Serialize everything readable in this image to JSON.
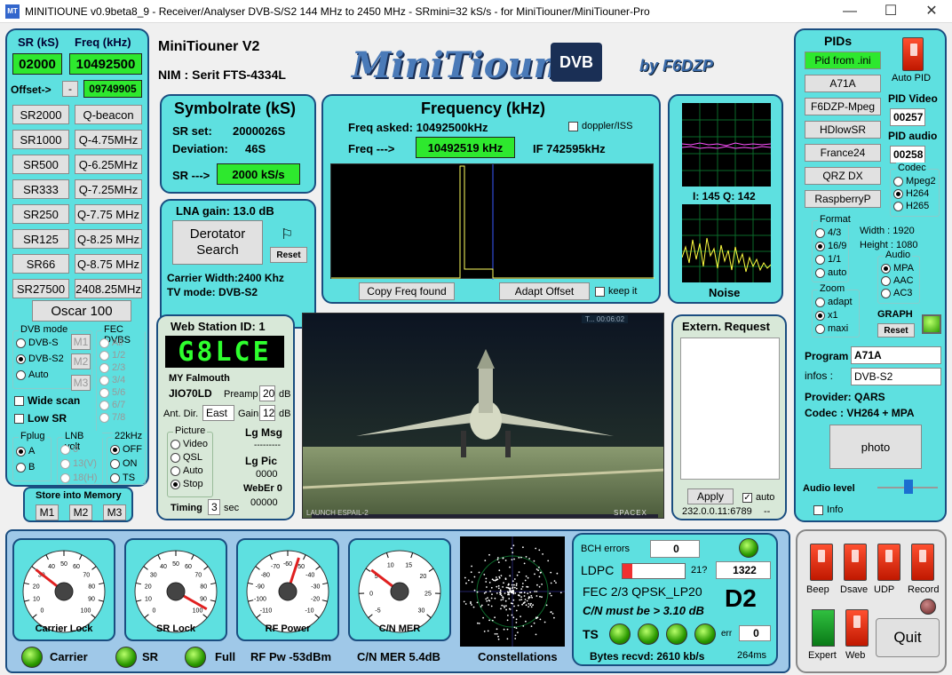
{
  "window": {
    "title": "MINITIOUNE v0.9beta8_9 - Receiver/Analyser DVB-S/S2 144 MHz to 2450 MHz - SRmini=32 kS/s - for MiniTiouner/MiniTiouner-Pro",
    "min": "—",
    "max": "☐",
    "close": "✕",
    "icon": "app-icon"
  },
  "header": {
    "model": "MiniTiouner V2",
    "nim": "NIM : Serit FTS-4334L",
    "logo_text": "MiniTioune",
    "logo_dvb": "DVB",
    "byline": "by F6DZP"
  },
  "left": {
    "sr_label": "SR (kS)",
    "freq_label": "Freq (kHz)",
    "sr_value": "02000",
    "freq_value": "10492500",
    "offset_label": "Offset->",
    "offset_sign": "-",
    "offset_value": "09749905",
    "sr_buttons": [
      "SR2000",
      "SR1000",
      "SR500",
      "SR333",
      "SR250",
      "SR125",
      "SR66",
      "SR27500"
    ],
    "freq_buttons": [
      "Q-beacon",
      "Q-4.75MHz",
      "Q-6.25MHz",
      "Q-7.25MHz",
      "Q-7.75 MHz",
      "Q-8.25 MHz",
      "Q-8.75 MHz",
      "2408.25MHz"
    ],
    "oscar": "Oscar 100",
    "dvbmode": {
      "title": "DVB mode",
      "options": [
        "DVB-S",
        "DVB-S2",
        "Auto"
      ],
      "selected": 1
    },
    "mem_buttons": [
      "M1",
      "M2",
      "M3"
    ],
    "fec": {
      "title": "FEC DVBS",
      "options": [
        "All",
        "1/2",
        "2/3",
        "3/4",
        "5/6",
        "6/7",
        "7/8"
      ]
    },
    "wide_scan": "Wide scan",
    "low_sr": "Low SR",
    "fplug": {
      "title": "Fplug",
      "options": [
        "A",
        "B"
      ]
    },
    "lnb": {
      "title": "LNB volt",
      "options": [
        "0",
        "13(V)",
        "18(H)"
      ]
    },
    "khz22": {
      "title": "22kHz",
      "options": [
        "OFF",
        "ON",
        "TS"
      ]
    },
    "store": {
      "title": "Store into Memory",
      "buttons": [
        "M1",
        "M2",
        "M3"
      ]
    }
  },
  "symbol": {
    "title": "Symbolrate (kS)",
    "srset_label": "SR set:",
    "srset_value": "2000026S",
    "dev_label": "Deviation:",
    "dev_value": "46S",
    "sr_arrow": "SR --->",
    "sr_value": "2000 kS/s"
  },
  "lna": {
    "gain": "LNA gain:  13.0 dB",
    "derot": "Derotator Search",
    "reset": "Reset",
    "flag": "flag-icon",
    "carrier": "Carrier Width:2400 Khz",
    "tvmode": "TV mode: DVB-S2"
  },
  "freq": {
    "title": "Frequency (kHz)",
    "asked": "Freq asked: 10492500kHz",
    "doppler": "doppler/ISS",
    "arrow": "Freq --->",
    "value": "10492519 kHz",
    "if": "IF  742595kHz",
    "copy": "Copy Freq found",
    "adapt": "Adapt Offset",
    "keep": "keep it"
  },
  "iq": {
    "text": "I: 145  Q: 142",
    "noise": "Noise"
  },
  "web": {
    "title": "Web Station ID: 1",
    "callsign": "G8LCE",
    "location": "MY Falmouth",
    "locator": "JIO70LD",
    "preamp_label": "Preamp",
    "preamp": "20",
    "db1": "dB",
    "ant_label": "Ant. Dir.",
    "ant": "East",
    "gain_label": "Gain",
    "gain": "12",
    "db2": "dB",
    "picture": {
      "title": "Picture",
      "options": [
        "Video",
        "QSL",
        "Auto",
        "Stop"
      ],
      "selected": 3
    },
    "lgmsg": "Lg Msg",
    "lgmsg_val": "---------",
    "lgpic": "Lg Pic",
    "lgpic_val": "0000",
    "weber": "WebEr 0",
    "weber_val": "00000",
    "timing": "Timing",
    "timing_val": "3",
    "sec": "sec"
  },
  "video": {
    "top_tag": "T...    00:06:02",
    "caption": "LAUNCH   ESPAIL-2",
    "brand": "SPACEX"
  },
  "extern": {
    "title": "Extern. Request",
    "apply": "Apply",
    "auto": "auto",
    "addr": "232.0.0.11:6789",
    "dash": "--"
  },
  "pids": {
    "title": "PIDs",
    "buttons": [
      "Pid from .ini",
      "A71A",
      "F6DZP-Mpeg",
      "HDlowSR",
      "France24",
      "QRZ DX",
      "RaspberryP"
    ],
    "auto_pid": "Auto PID",
    "pid_video_label": "PID Video",
    "pid_video": "00257",
    "pid_audio_label": "PID audio",
    "pid_audio": "00258",
    "codec": {
      "title": "Codec",
      "options": [
        "Mpeg2",
        "H264",
        "H265"
      ],
      "selected": 1
    },
    "format": {
      "title": "Format",
      "options": [
        "4/3",
        "16/9",
        "1/1",
        "auto"
      ],
      "selected": 1
    },
    "width": "Width :    1920",
    "height": "Height :   1080",
    "audio": {
      "title": "Audio",
      "options": [
        "MPA",
        "AAC",
        "AC3"
      ],
      "selected": 0
    },
    "zoom": {
      "title": "Zoom",
      "options": [
        "adapt",
        "x1",
        "maxi"
      ],
      "selected": 1
    },
    "graph": "GRAPH",
    "graph_reset": "Reset",
    "program_label": "Program",
    "program": "A71A",
    "infos_label": "infos :",
    "infos": "DVB-S2",
    "provider": "Provider: QARS",
    "codec_line": "Codec :    VH264 + MPA",
    "photo": "photo",
    "audio_level": "Audio level",
    "info": "Info"
  },
  "gauges": [
    {
      "name": "Carrier Lock",
      "ticks": [
        "0",
        "10",
        "20",
        "30",
        "40",
        "50",
        "60",
        "70",
        "80",
        "90",
        "100"
      ],
      "value": 30
    },
    {
      "name": "SR Lock",
      "ticks": [
        "0",
        "10",
        "20",
        "30",
        "40",
        "50",
        "60",
        "70",
        "80",
        "90",
        "100"
      ],
      "value": 96
    },
    {
      "name": "RF Power",
      "ticks": [
        "-110",
        "-100",
        "-90",
        "-80",
        "-70",
        "-60",
        "-50",
        "-40",
        "-30",
        "-20",
        "-10"
      ],
      "value": -53
    },
    {
      "name": "C/N MER",
      "ticks": [
        "-5",
        "0",
        "5",
        "10",
        "15",
        "20",
        "25",
        "30"
      ],
      "value": 5.4
    }
  ],
  "bottom": {
    "carrier": "Carrier",
    "sr": "SR",
    "full": "Full",
    "rfpw": "RF Pw -53dBm",
    "cnmer": "C/N MER 5.4dB",
    "constell": "Constellations"
  },
  "status": {
    "bch_label": "BCH errors",
    "bch": "0",
    "ldpc_label": "LDPC",
    "ldpc_num": "21?",
    "ldpc_box": "1322",
    "ldpc_fill": 0.15,
    "fec": "FEC  2/3 QPSK_LP20",
    "cn": "C/N must be > 3.10 dB",
    "d2": "D2",
    "ts": "TS",
    "err": "err",
    "err_val": "0",
    "bytes": "Bytes recvd:  2610 kb/s",
    "ms": "264ms"
  },
  "controls": {
    "switches": [
      "Beep",
      "Dsave",
      "UDP",
      "Record"
    ],
    "expert": "Expert",
    "web": "Web",
    "quit": "Quit"
  },
  "colors": {
    "panel": "#5ee0e0",
    "border": "#1a4d80",
    "lcd": "#2ee82e"
  }
}
